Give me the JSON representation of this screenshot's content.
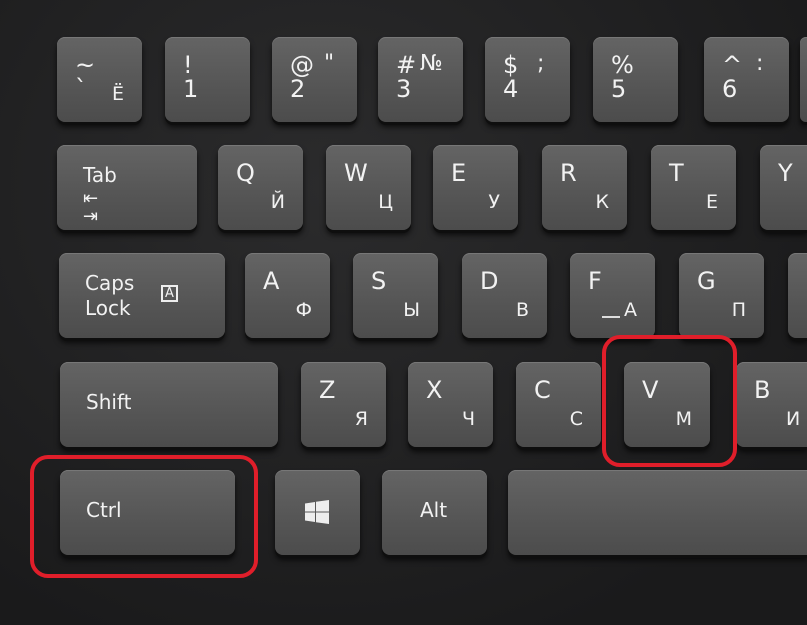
{
  "highlight_color": "#e01e2a",
  "row1": [
    {
      "top": "~",
      "bottom": "`",
      "ru": "Ё"
    },
    {
      "top": "!",
      "bottom": "1"
    },
    {
      "top": "@",
      "bottom": "2",
      "ru": "\""
    },
    {
      "top": "#",
      "bottom": "3",
      "ru": "№"
    },
    {
      "top": "$",
      "bottom": "4",
      "ru": ";"
    },
    {
      "top": "%",
      "bottom": "5"
    },
    {
      "top": "^",
      "bottom": "6",
      "ru": ":"
    }
  ],
  "row2": {
    "tab": "Tab",
    "tab_icon": "tab-arrows-icon",
    "keys": [
      {
        "en": "Q",
        "ru": "Й"
      },
      {
        "en": "W",
        "ru": "Ц"
      },
      {
        "en": "E",
        "ru": "У"
      },
      {
        "en": "R",
        "ru": "К"
      },
      {
        "en": "T",
        "ru": "Е"
      },
      {
        "en": "Y",
        "ru": ""
      }
    ]
  },
  "row3": {
    "caps1": "Caps",
    "caps2": "Lock",
    "caps_icon": "A",
    "keys": [
      {
        "en": "A",
        "ru": "Ф"
      },
      {
        "en": "S",
        "ru": "Ы"
      },
      {
        "en": "D",
        "ru": "В"
      },
      {
        "en": "F",
        "ru": "А"
      },
      {
        "en": "G",
        "ru": "П"
      }
    ]
  },
  "row4": {
    "shift": "Shift",
    "keys": [
      {
        "en": "Z",
        "ru": "Я"
      },
      {
        "en": "X",
        "ru": "Ч"
      },
      {
        "en": "C",
        "ru": "С"
      },
      {
        "en": "V",
        "ru": "М"
      },
      {
        "en": "B",
        "ru": "И"
      }
    ]
  },
  "row5": {
    "ctrl": "Ctrl",
    "win_icon": "windows-logo-icon",
    "alt": "Alt"
  }
}
